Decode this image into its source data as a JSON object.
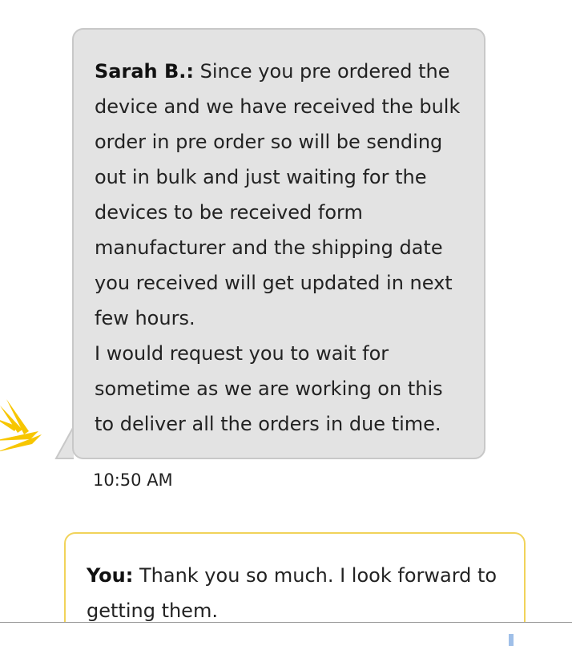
{
  "agent_message": {
    "sender": "Sarah B.:",
    "lines": [
      " Since you pre ordered the",
      "device and we have received the bulk",
      "order in pre order so will be sending",
      "out in bulk and just waiting for the",
      "devices to be received form",
      "manufacturer and the shipping date",
      "you received will get updated in next",
      "few hours.",
      "I would request you to wait for",
      "sometime as we are working on this",
      "to deliver all the orders in due time."
    ],
    "time": "10:50 AM"
  },
  "user_message": {
    "sender": "You:",
    "lines": [
      " Thank you so much. I look forward to",
      "getting them."
    ]
  },
  "colors": {
    "agent_bubble": "#e3e3e3",
    "user_bubble_border": "#f1d35a",
    "brand_logo": "#f7c600"
  },
  "icons": {
    "brand_logo": "sprint-brand-logo-icon"
  }
}
